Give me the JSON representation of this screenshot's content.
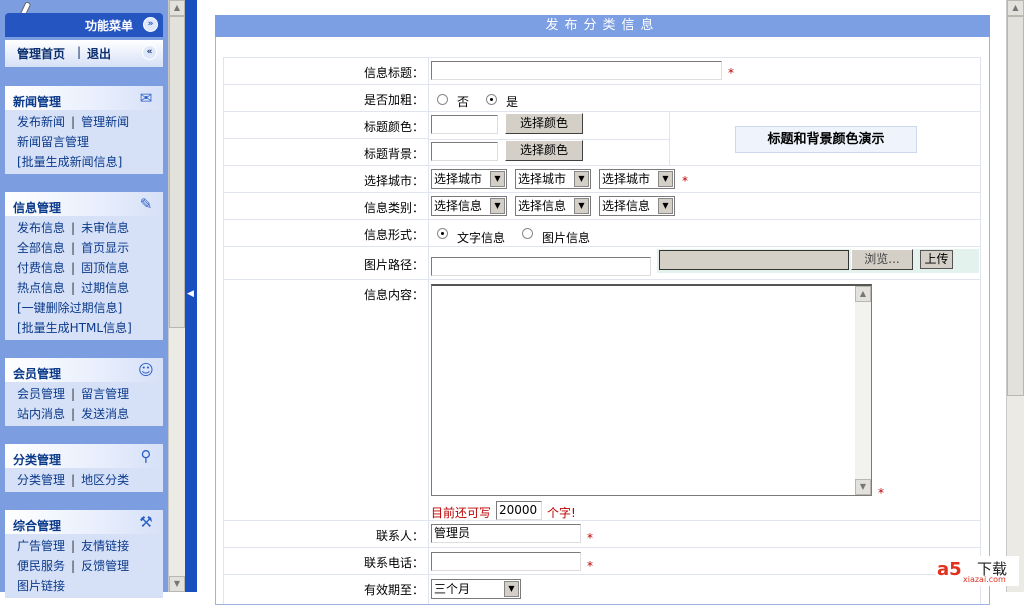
{
  "sidebar": {
    "menu_title": "功能菜单",
    "home": "管理首页",
    "sep": "|",
    "logout": "退出",
    "groups": [
      {
        "title": "新闻管理",
        "icon": "news-icon",
        "rows": [
          [
            "发布新闻",
            "管理新闻"
          ],
          [
            "新闻留言管理"
          ],
          [
            "[批量生成新闻信息]"
          ]
        ]
      },
      {
        "title": "信息管理",
        "icon": "edit-icon",
        "rows": [
          [
            "发布信息",
            "未审信息"
          ],
          [
            "全部信息",
            "首页显示"
          ],
          [
            "付费信息",
            "固顶信息"
          ],
          [
            "热点信息",
            "过期信息"
          ],
          [
            "[一键删除过期信息]"
          ],
          [
            "[批量生成HTML信息]"
          ]
        ]
      },
      {
        "title": "会员管理",
        "icon": "user-icon",
        "rows": [
          [
            "会员管理",
            "留言管理"
          ],
          [
            "站内消息",
            "发送消息"
          ]
        ]
      },
      {
        "title": "分类管理",
        "icon": "search-icon",
        "rows": [
          [
            "分类管理",
            "地区分类"
          ]
        ]
      },
      {
        "title": "综合管理",
        "icon": "tools-icon",
        "rows": [
          [
            "广告管理",
            "友情链接"
          ],
          [
            "便民服务",
            "反馈管理"
          ],
          [
            "图片链接"
          ]
        ]
      }
    ]
  },
  "main": {
    "title": "发布分类信息",
    "labels": {
      "title": "信息标题：",
      "bold": "是否加粗：",
      "title_color": "标题颜色：",
      "title_bg": "标题背景：",
      "city": "选择城市：",
      "category": "信息类别：",
      "form": "信息形式：",
      "image_path": "图片路径：",
      "content": "信息内容：",
      "contact": "联系人：",
      "phone": "联系电话：",
      "valid": "有效期至："
    },
    "bold_options": [
      "否",
      "是"
    ],
    "bold_selected": "是",
    "choose_color": "选择颜色",
    "color_demo": "标题和背景颜色演示",
    "city_select": "选择城市",
    "category_select": "选择信息",
    "form_options": [
      "文字信息",
      "图片信息"
    ],
    "form_selected": "文字信息",
    "browse": "浏览...",
    "upload": "上传",
    "remaining_prefix": "目前还可写",
    "remaining": "20000",
    "remaining_suffix": "个字!",
    "contact_value": "管理员",
    "phone_value": "",
    "valid_value": "三个月",
    "required": "*"
  },
  "watermark": {
    "text": "下载",
    "sub": "xiazai.com"
  }
}
